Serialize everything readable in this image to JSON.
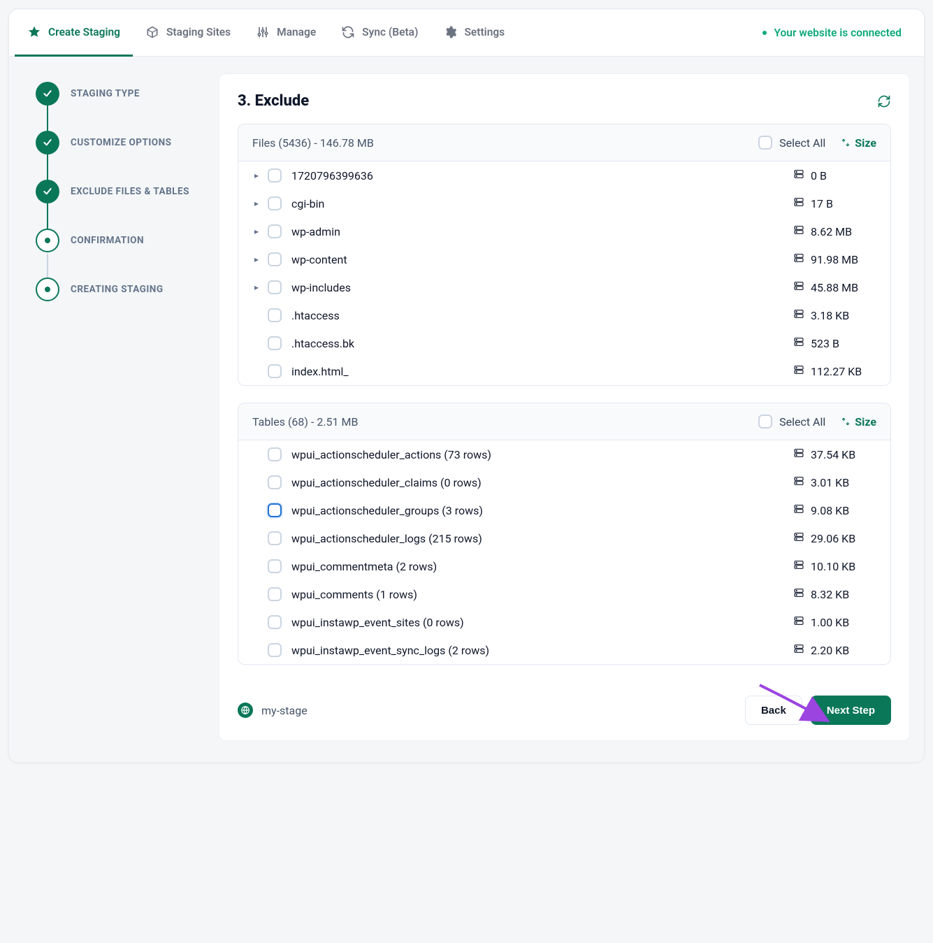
{
  "nav": {
    "tabs": [
      {
        "id": "tab-create-staging",
        "label": "Create Staging",
        "icon": "star-icon",
        "active": true
      },
      {
        "id": "tab-staging-sites",
        "label": "Staging Sites",
        "icon": "cube-icon",
        "active": false
      },
      {
        "id": "tab-manage",
        "label": "Manage",
        "icon": "sliders-icon",
        "active": false
      },
      {
        "id": "tab-sync",
        "label": "Sync (Beta)",
        "icon": "sync-icon",
        "active": false
      },
      {
        "id": "tab-settings",
        "label": "Settings",
        "icon": "gear-icon",
        "active": false
      }
    ],
    "connected_text": "Your website is connected"
  },
  "steps": [
    {
      "label": "STAGING TYPE",
      "state": "done"
    },
    {
      "label": "CUSTOMIZE OPTIONS",
      "state": "done"
    },
    {
      "label": "EXCLUDE FILES & TABLES",
      "state": "done"
    },
    {
      "label": "CONFIRMATION",
      "state": "current"
    },
    {
      "label": "CREATING STAGING",
      "state": "pending"
    }
  ],
  "main": {
    "title": "3. Exclude",
    "files_panel": {
      "title": "Files (5436) - 146.78 MB",
      "select_all_label": "Select All",
      "sort_label": "Size",
      "rows": [
        {
          "name": "1720796399636",
          "size": "0 B",
          "folder": true
        },
        {
          "name": "cgi-bin",
          "size": "17 B",
          "folder": true
        },
        {
          "name": "wp-admin",
          "size": "8.62 MB",
          "folder": true
        },
        {
          "name": "wp-content",
          "size": "91.98 MB",
          "folder": true
        },
        {
          "name": "wp-includes",
          "size": "45.88 MB",
          "folder": true
        },
        {
          "name": ".htaccess",
          "size": "3.18 KB",
          "folder": false
        },
        {
          "name": ".htaccess.bk",
          "size": "523 B",
          "folder": false
        },
        {
          "name": "index.html_",
          "size": "112.27 KB",
          "folder": false
        }
      ]
    },
    "tables_panel": {
      "title": "Tables (68) - 2.51 MB",
      "select_all_label": "Select All",
      "sort_label": "Size",
      "rows": [
        {
          "name": "wpui_actionscheduler_actions (73 rows)",
          "size": "37.54 KB",
          "focused": false
        },
        {
          "name": "wpui_actionscheduler_claims (0 rows)",
          "size": "3.01 KB",
          "focused": false
        },
        {
          "name": "wpui_actionscheduler_groups (3 rows)",
          "size": "9.08 KB",
          "focused": true
        },
        {
          "name": "wpui_actionscheduler_logs (215 rows)",
          "size": "29.06 KB",
          "focused": false
        },
        {
          "name": "wpui_commentmeta (2 rows)",
          "size": "10.10 KB",
          "focused": false
        },
        {
          "name": "wpui_comments (1 rows)",
          "size": "8.32 KB",
          "focused": false
        },
        {
          "name": "wpui_instawp_event_sites (0 rows)",
          "size": "1.00 KB",
          "focused": false
        },
        {
          "name": "wpui_instawp_event_sync_logs (2 rows)",
          "size": "2.20 KB",
          "focused": false
        }
      ]
    }
  },
  "footer": {
    "site_name": "my-stage",
    "back_label": "Back",
    "next_label": "Next Step"
  },
  "colors": {
    "accent": "#0a7759",
    "accent_light": "#0ea97a",
    "arrow": "#9b44e0"
  }
}
